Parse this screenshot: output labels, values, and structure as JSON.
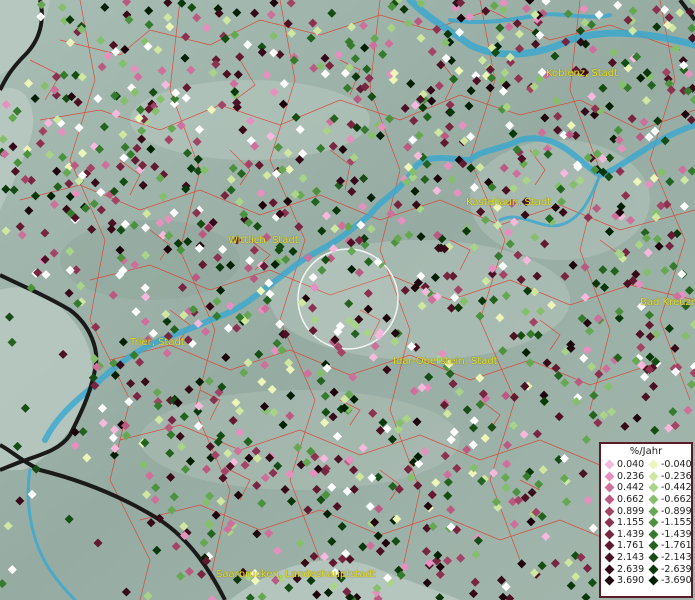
{
  "map": {
    "cities": [
      {
        "id": "koblenz",
        "label": "Koblenz, Stadt"
      },
      {
        "id": "kastellaun",
        "label": "Kastellaun, Stadt"
      },
      {
        "id": "wittlich",
        "label": "Wittlich, Stadt"
      },
      {
        "id": "trier",
        "label": "Trier, Stadt"
      },
      {
        "id": "idar-oberstein",
        "label": "Idar-Oberstein, Stadt"
      },
      {
        "id": "bad-kreuznach",
        "label": "Bad Kreuzn"
      },
      {
        "id": "saarbruecken",
        "label": "Saarbrücken, Landeshauptstadt"
      }
    ],
    "colors": {
      "terrain": "#9fb3aa",
      "river": "#38a8d0",
      "boundary_red": "#e03a2a",
      "country_border": "#1a1a1a",
      "city_text": "#e8e020",
      "selection_circle": "#ffffff"
    }
  },
  "legend": {
    "title": "%/Jahr",
    "positive": [
      {
        "value": "0.040",
        "color": "#f6b8dc"
      },
      {
        "value": "0.236",
        "color": "#e690bf"
      },
      {
        "value": "0.442",
        "color": "#cf6f9b"
      },
      {
        "value": "0.662",
        "color": "#bb5a80"
      },
      {
        "value": "0.899",
        "color": "#a34466"
      },
      {
        "value": "1.155",
        "color": "#8c3150"
      },
      {
        "value": "1.439",
        "color": "#772540"
      },
      {
        "value": "1.761",
        "color": "#621a31"
      },
      {
        "value": "2.143",
        "color": "#4c1124"
      },
      {
        "value": "2.639",
        "color": "#360a18"
      },
      {
        "value": "3.690",
        "color": "#1e040c"
      }
    ],
    "negative": [
      {
        "value": "-0.040",
        "color": "#eef5b8"
      },
      {
        "value": "-0.236",
        "color": "#cfe7a0"
      },
      {
        "value": "-0.442",
        "color": "#a9d487"
      },
      {
        "value": "-0.662",
        "color": "#86bf6c"
      },
      {
        "value": "-0.899",
        "color": "#66a852"
      },
      {
        "value": "-1.155",
        "color": "#4b913e"
      },
      {
        "value": "-1.439",
        "color": "#357a2d"
      },
      {
        "value": "-1.761",
        "color": "#23631f"
      },
      {
        "value": "-2.143",
        "color": "#154d14"
      },
      {
        "value": "-2.639",
        "color": "#0a380b"
      },
      {
        "value": "-3.690",
        "color": "#032004"
      }
    ]
  }
}
